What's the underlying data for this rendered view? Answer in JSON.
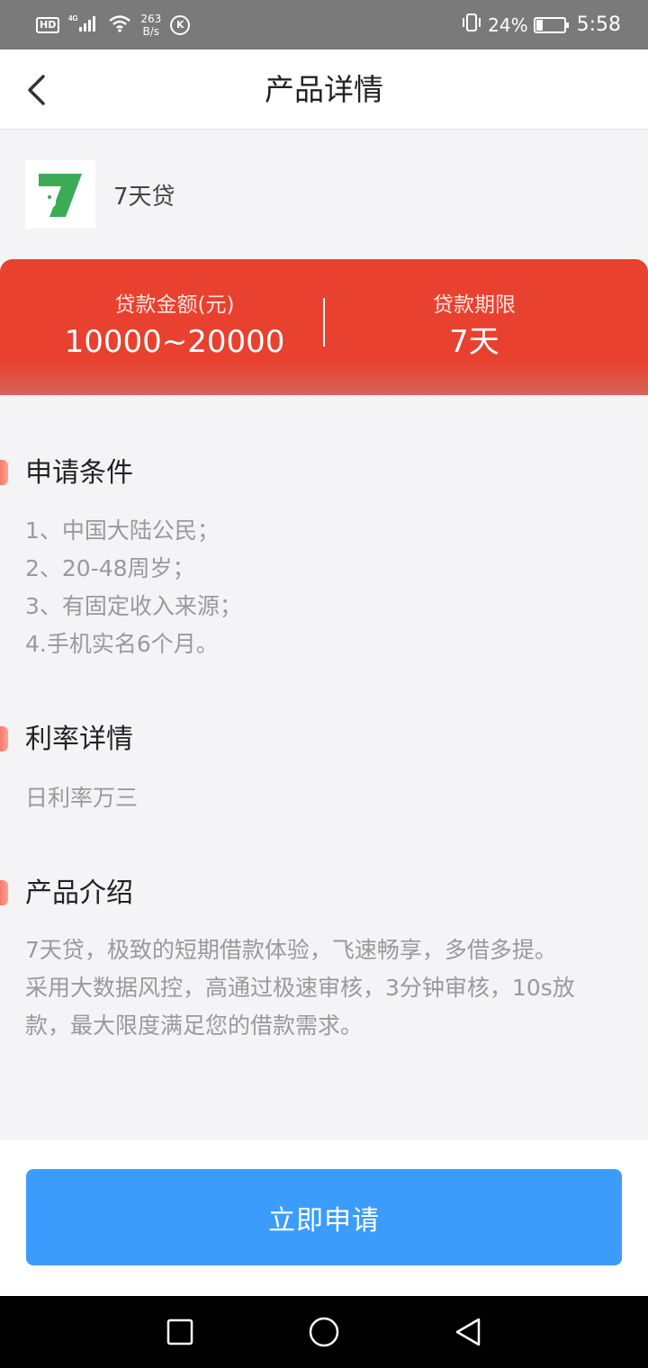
{
  "status_bar": {
    "hd": "HD",
    "network": "4G",
    "speed_value": "263",
    "speed_unit": "B/s",
    "k_badge": "K",
    "battery_percent": "24%",
    "battery_level": 0.24,
    "time": "5:58",
    "icons": [
      "hd-icon",
      "signal-icon",
      "wifi-icon",
      "k-icon",
      "vibrate-icon",
      "battery-icon"
    ]
  },
  "nav": {
    "title": "产品详情",
    "back_icon": "chevron-left-icon"
  },
  "product": {
    "name": "7天贷",
    "logo_icon": "product-logo-icon",
    "logo_text": "7"
  },
  "loan": {
    "amount_label": "贷款金额(元)",
    "amount_value": "10000~20000",
    "term_label": "贷款期限",
    "term_value": "7天"
  },
  "sections": {
    "conditions": {
      "title": "申请条件",
      "lines": [
        "1、中国大陆公民；",
        "2、20-48周岁；",
        "3、有固定收入来源；",
        "4.手机实名6个月。"
      ]
    },
    "rate": {
      "title": "利率详情",
      "text": "日利率万三"
    },
    "intro": {
      "title": "产品介绍",
      "lines": [
        "7天贷，极致的短期借款体验，飞速畅享，多借多提。",
        "采用大数据风控，高通过极速审核，3分钟审核，10s放",
        "款，最大限度满足您的借款需求。"
      ]
    }
  },
  "actions": {
    "apply_label": "立即申请"
  },
  "system_nav": {
    "icons": [
      "recent-apps-icon",
      "home-icon",
      "back-icon"
    ]
  },
  "colors": {
    "accent_red": "#e8412f",
    "button_blue": "#3b9cfb",
    "marker": "#f47a6c"
  }
}
